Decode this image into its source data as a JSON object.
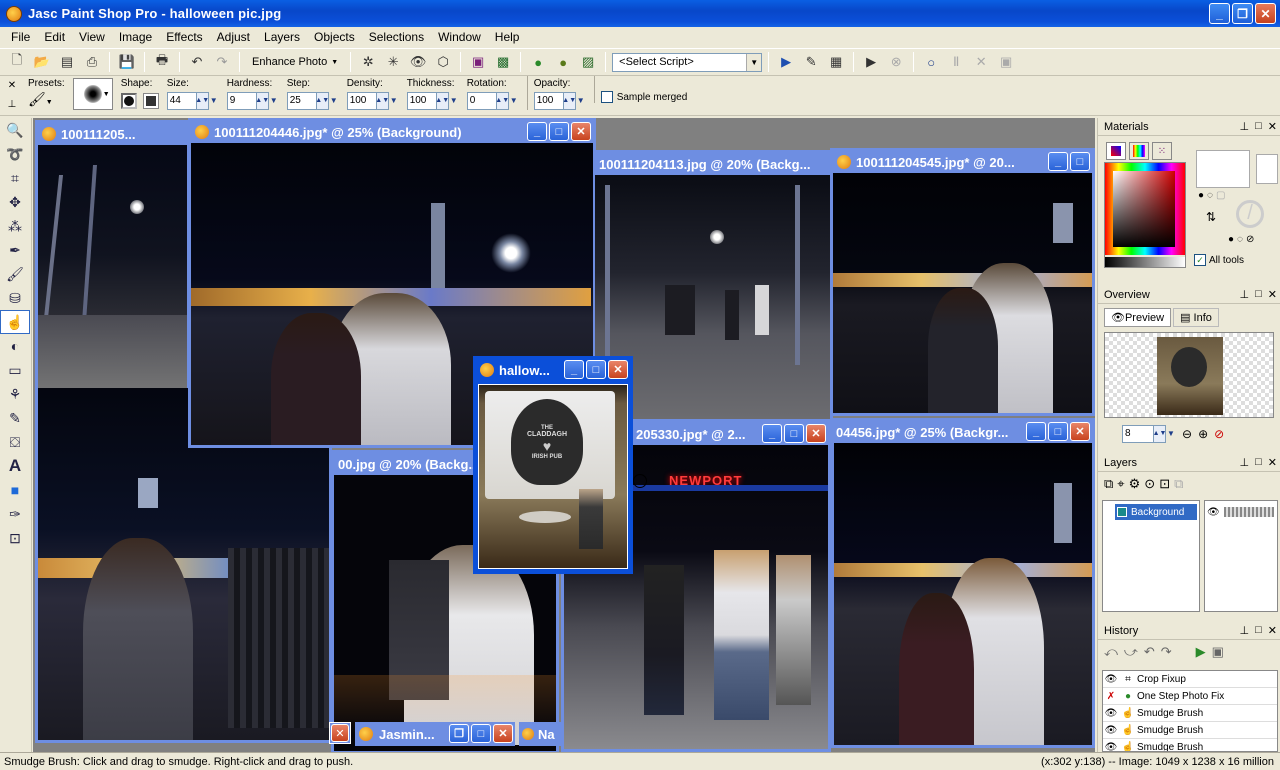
{
  "window": {
    "title": "Jasc Paint Shop Pro - halloween pic.jpg"
  },
  "menu": [
    "File",
    "Edit",
    "View",
    "Image",
    "Effects",
    "Adjust",
    "Layers",
    "Objects",
    "Selections",
    "Window",
    "Help"
  ],
  "toolbar": {
    "enhance_photo": "Enhance Photo",
    "select_script": "<Select Script>"
  },
  "tool_options": {
    "presets_label": "Presets:",
    "shape_label": "Shape:",
    "size_label": "Size:",
    "size": "44",
    "hardness_label": "Hardness:",
    "hardness": "9",
    "step_label": "Step:",
    "step": "25",
    "density_label": "Density:",
    "density": "100",
    "thickness_label": "Thickness:",
    "thickness": "100",
    "rotation_label": "Rotation:",
    "rotation": "0",
    "opacity_label": "Opacity:",
    "opacity": "100",
    "sample_merged": "Sample merged"
  },
  "documents": [
    {
      "title": "100111205...",
      "key": "d1"
    },
    {
      "title": "100111204446.jpg* @  25% (Background)",
      "key": "d2"
    },
    {
      "title": "100111204113.jpg @  20% (Backg...",
      "key": "d3"
    },
    {
      "title": "100111204545.jpg* @  20...",
      "key": "d4"
    },
    {
      "title": "hallow...",
      "key": "d5"
    },
    {
      "title": "205330.jpg* @  2...",
      "key": "d6"
    },
    {
      "title": "04456.jpg* @  25% (Backgr...",
      "key": "d7"
    },
    {
      "title": "00.jpg @  20% (Backg...",
      "key": "d8"
    },
    {
      "title": "Jasmin...",
      "key": "d9"
    },
    {
      "title": "Na",
      "key": "d10"
    }
  ],
  "photo_text": {
    "pub_sign_line1": "THE",
    "pub_sign_line2": "CLADDAGH",
    "pub_sign_line3": "IRISH PUB",
    "neon": "NEWPORT"
  },
  "materials": {
    "title": "Materials",
    "all_tools": "All tools"
  },
  "overview": {
    "title": "Overview",
    "tab_preview": "Preview",
    "tab_info": "Info",
    "zoom": "8"
  },
  "layers": {
    "title": "Layers",
    "layer_name": "Background"
  },
  "history": {
    "title": "History",
    "items": [
      "Crop Fixup",
      "One Step Photo Fix",
      "Smudge Brush",
      "Smudge Brush",
      "Smudge Brush"
    ]
  },
  "status": {
    "left": "Smudge Brush: Click and drag to smudge. Right-click and drag to push.",
    "right": "(x:302 y:138) -- Image:  1049 x 1238 x 16 million"
  },
  "colors": {
    "title_blue": "#0b4fd9",
    "inactive_blue": "#6e8ee2",
    "panel_bg": "#ece9d8"
  }
}
